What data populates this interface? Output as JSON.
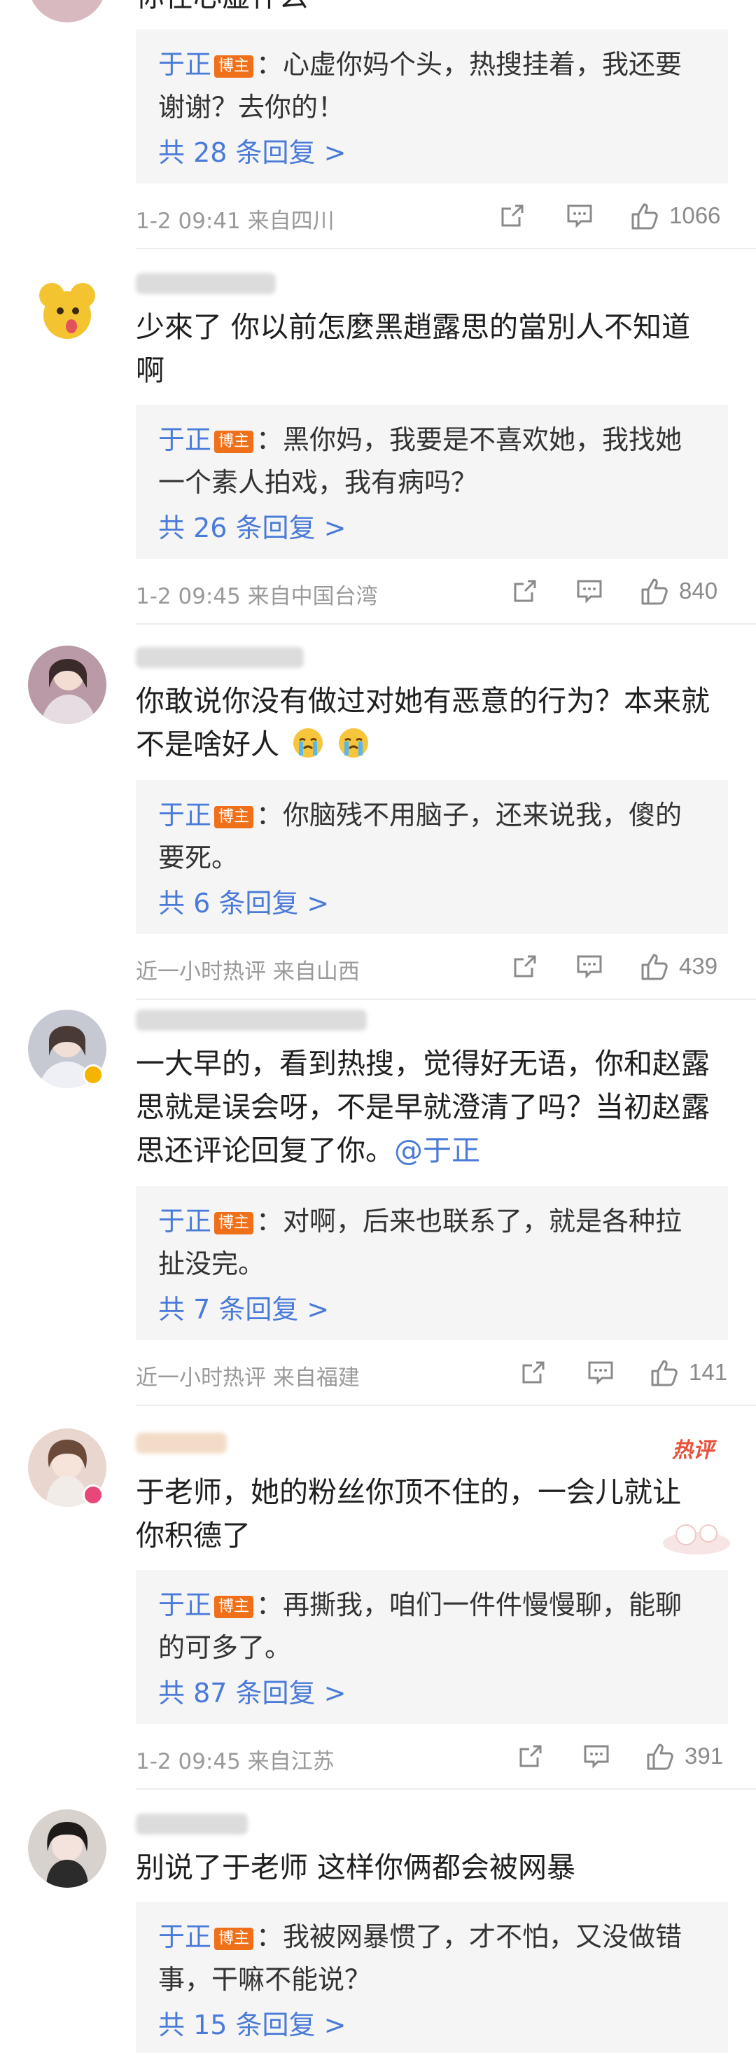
{
  "badge_label": "博主",
  "comments": [
    {
      "text": "你在心虚什么",
      "reply": {
        "author": "于正",
        "lines": [
          "：心虚你妈个头，热搜挂着，我还要",
          "谢谢？去你的！"
        ],
        "more": "共 28 条回复 >"
      },
      "meta": "1-2 09:41  来自四川",
      "likes": "1066"
    },
    {
      "lines": [
        "少來了 你以前怎麼黑趙露思的當別人不知道",
        "啊"
      ],
      "reply": {
        "author": "于正",
        "lines": [
          "：黑你妈，我要是不喜欢她，我找她",
          "一个素人拍戏，我有病吗？"
        ],
        "more": "共 26 条回复 >"
      },
      "meta": "1-2 09:45  来自中国台湾",
      "likes": "840"
    },
    {
      "lines": [
        "你敢说你没有做过对她有恶意的行为？本来就",
        "不是啥好人"
      ],
      "reply": {
        "author": "于正",
        "lines": [
          "：你脑残不用脑子，还来说我，傻的",
          "要死。"
        ],
        "more": "共 6 条回复 >"
      },
      "meta": "近一小时热评  来自山西",
      "likes": "439"
    },
    {
      "lines": [
        "一大早的，看到热搜，觉得好无语，你和赵露",
        "思就是误会呀，不是早就澄清了吗？当初赵露",
        "思还评论回复了你。"
      ],
      "mention": "@于正",
      "reply": {
        "author": "于正",
        "lines": [
          "：对啊，后来也联系了，就是各种拉",
          "扯没完。"
        ],
        "more": "共 7 条回复 >"
      },
      "meta": "近一小时热评  来自福建",
      "likes": "141"
    },
    {
      "hot": "热评",
      "lines": [
        "于老师，她的粉丝你顶不住的，一会儿就让",
        "你积德了"
      ],
      "reply": {
        "author": "于正",
        "lines": [
          "：再撕我，咱们一件件慢慢聊，能聊",
          "的可多了。"
        ],
        "more": "共 87 条回复 >"
      },
      "meta": "1-2 09:45  来自江苏",
      "likes": "391"
    },
    {
      "lines": [
        "别说了于老师 这样你俩都会被网暴"
      ],
      "reply": {
        "author": "于正",
        "lines": [
          "：我被网暴惯了，才不怕，又没做错",
          "事，干嘛不能说？"
        ],
        "more": "共 15 条回复 >"
      }
    }
  ],
  "icons": {
    "share": "share-icon",
    "comment": "comment-icon",
    "like": "like-icon",
    "emoji": "crying-face-emoji"
  },
  "colors": {
    "link": "#4a7bd8",
    "badge": "#f0701a",
    "reply_bg": "#f5f5f5",
    "meta": "#9a9a9a",
    "hot": "#e8503a"
  }
}
